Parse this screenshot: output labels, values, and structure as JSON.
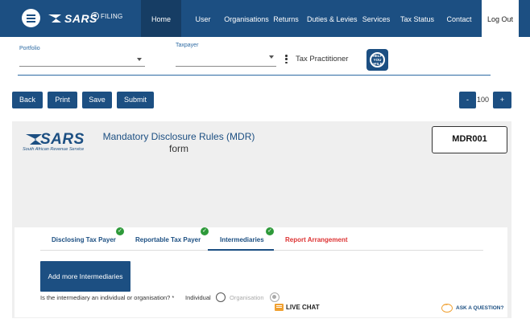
{
  "colors": {
    "brand": "#1c4f82",
    "brand_dark": "#163d64",
    "success": "#2e9a3a",
    "alert": "#dd3333",
    "accent": "#f0a030"
  },
  "header": {
    "brand": "SARS",
    "efiling_label": "FILING",
    "nav": [
      "Home",
      "User",
      "Organisations",
      "Returns",
      "Duties & Levies",
      "Services",
      "Tax Status",
      "Contact",
      "Log Out"
    ],
    "active": "Home"
  },
  "filters": {
    "portfolio_label": "Portfolio",
    "portfolio_value": "",
    "taxpayer_label": "Taxpayer",
    "taxpayer_value": "",
    "role": "Tax Practitioner",
    "help_icon": "help-you-efile-icon",
    "help_text": "HELP YOU eFILE"
  },
  "toolbar": {
    "back": "Back",
    "print": "Print",
    "save": "Save",
    "submit": "Submit",
    "zoom_out": "-",
    "zoom_value": "100",
    "zoom_in": "+"
  },
  "form": {
    "logo_word": "SARS",
    "logo_sub": "South African Revenue Service",
    "title_line1": "Mandatory Disclosure Rules (MDR)",
    "title_line2": "form",
    "code": "MDR001"
  },
  "tabs": [
    {
      "label": "Disclosing Tax Payer",
      "complete": true,
      "active": false
    },
    {
      "label": "Reportable Tax Payer",
      "complete": true,
      "active": false
    },
    {
      "label": "Intermediaries",
      "complete": true,
      "active": true
    },
    {
      "label": "Report Arrangement",
      "complete": false,
      "active": false
    }
  ],
  "intermediaries": {
    "add_button": "Add more Intermediaries",
    "question": "Is the intermediary an individual or organisation? *",
    "options": [
      "Individual",
      "Organisation"
    ],
    "selected": "Organisation"
  },
  "footer": {
    "live_chat": "LIVE CHAT",
    "ask": "ASK A QUESTION?"
  }
}
